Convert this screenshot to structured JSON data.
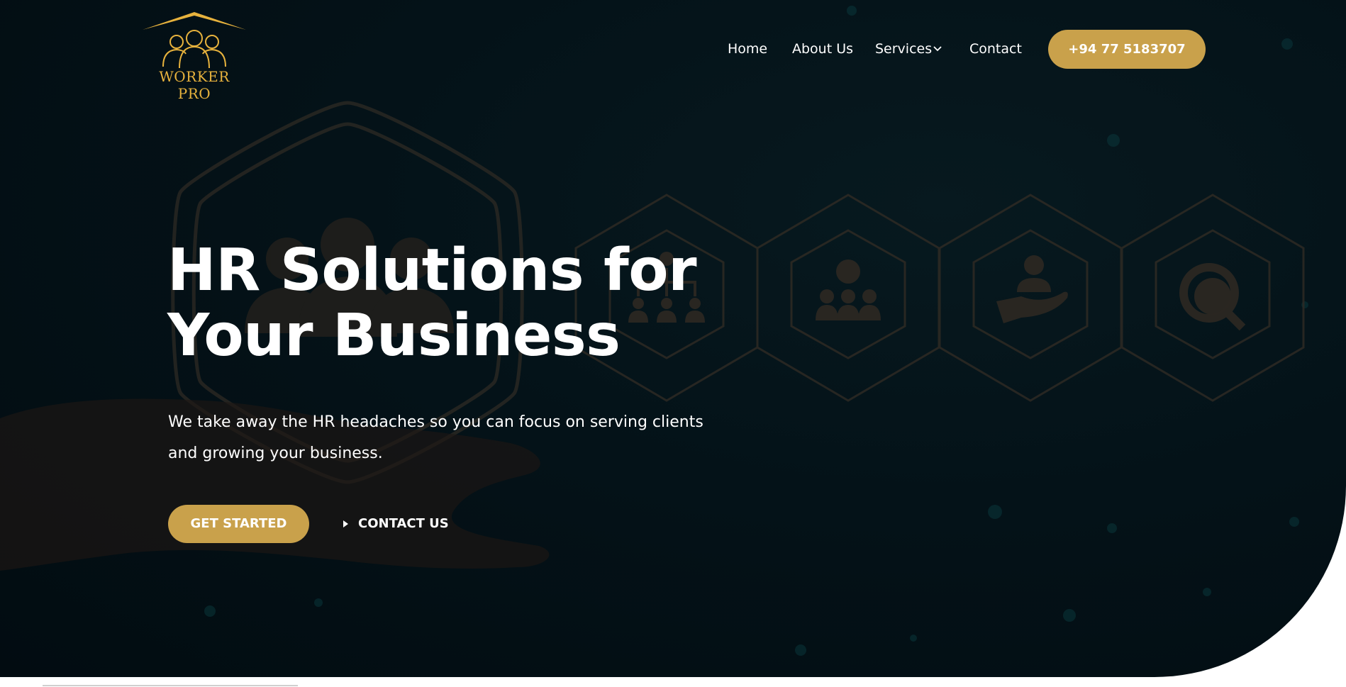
{
  "brand": {
    "name": "WORKER PRO",
    "logo_icon": "people-roof-icon",
    "color": "#e7b23d"
  },
  "nav": {
    "items": [
      {
        "label": "Home"
      },
      {
        "label": "About Us"
      },
      {
        "label": "Services",
        "icon": "chevron-down-icon"
      },
      {
        "label": "Contact"
      }
    ],
    "phone_button": "+94 77 5183707"
  },
  "hero": {
    "title_line1": "HR Solutions for",
    "title_line2": "Your Business",
    "subtitle_line1": "We take away the HR headaches so you can focus on serving clients",
    "subtitle_line2": "and growing your business.",
    "primary_button": "GET STARTED",
    "secondary_button": "CONTACT US",
    "secondary_icon": "play-icon"
  },
  "background_icons": [
    "people-group-icon",
    "org-chart-icon",
    "team-check-icon",
    "hand-user-icon",
    "search-user-icon"
  ],
  "colors": {
    "accent": "#c9a14b",
    "background": "#041218",
    "text": "#ffffff"
  }
}
